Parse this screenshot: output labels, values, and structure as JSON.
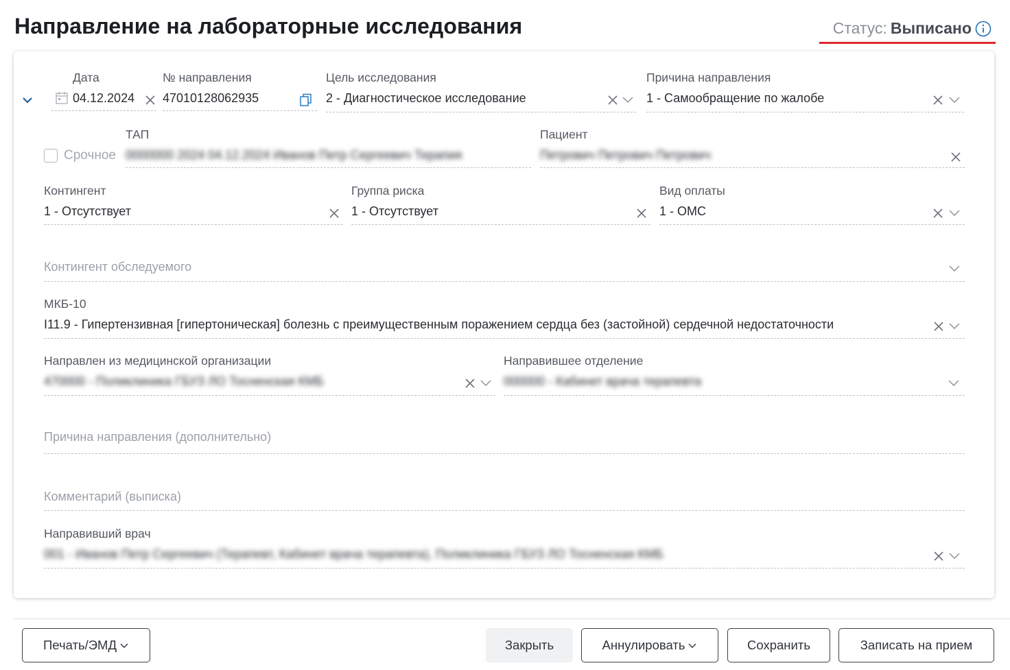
{
  "header": {
    "title": "Направление на лабораторные исследования",
    "status_label": "Статус:",
    "status_value": "Выписано",
    "status_icon": "info-icon",
    "accent_color": "#e0262a"
  },
  "form": {
    "date": {
      "label": "Дата",
      "value": "04.12.2024"
    },
    "referral_number": {
      "label": "№ направления",
      "value": "47010128062935"
    },
    "purpose": {
      "label": "Цель исследования",
      "value": "2 - Диагностическое исследование"
    },
    "reason": {
      "label": "Причина направления",
      "value": "1 - Самообращение по жалобе"
    },
    "urgent": {
      "label": "Срочное",
      "checked": false
    },
    "tap": {
      "label": "ТАП",
      "value": "0000000 2024 04.12.2024 Иванов Петр Сергеевич Терапия"
    },
    "patient": {
      "label": "Пациент",
      "value": "Петрович Петрович Петрович"
    },
    "contingent": {
      "label": "Контингент",
      "value": "1 - Отсутствует"
    },
    "risk_group": {
      "label": "Группа риска",
      "value": "1 - Отсутствует"
    },
    "payment_type": {
      "label": "Вид оплаты",
      "value": "1 - ОМС"
    },
    "examinee_contingent": {
      "placeholder": "Контингент обследуемого"
    },
    "icd10": {
      "label": "МКБ-10",
      "value": "I11.9 - Гипертензивная [гипертоническая] болезнь с преимущественным поражением сердца без (застойной) сердечной недостаточности"
    },
    "referring_org": {
      "label": "Направлен из медицинской организации",
      "value": "470000 - Поликлиника ГБУЗ ЛО Тосненская КМБ"
    },
    "referring_dept": {
      "label": "Направившее отделение",
      "value": "000000 - Кабинет врача терапевта"
    },
    "reason_extra": {
      "placeholder": "Причина направления (дополнительно)"
    },
    "comment": {
      "placeholder": "Комментарий (выписка)"
    },
    "referring_doctor": {
      "label": "Направивший врач",
      "value": "001 - Иванов Петр Сергеевич (Терапевт, Кабинет врача терапевта), Поликлиника ГБУЗ ЛО Тосненская КМБ"
    }
  },
  "footer": {
    "print_label": "Печать/ЭМД",
    "close_label": "Закрыть",
    "annul_label": "Аннулировать",
    "save_label": "Сохранить",
    "appointment_label": "Записать на прием"
  }
}
